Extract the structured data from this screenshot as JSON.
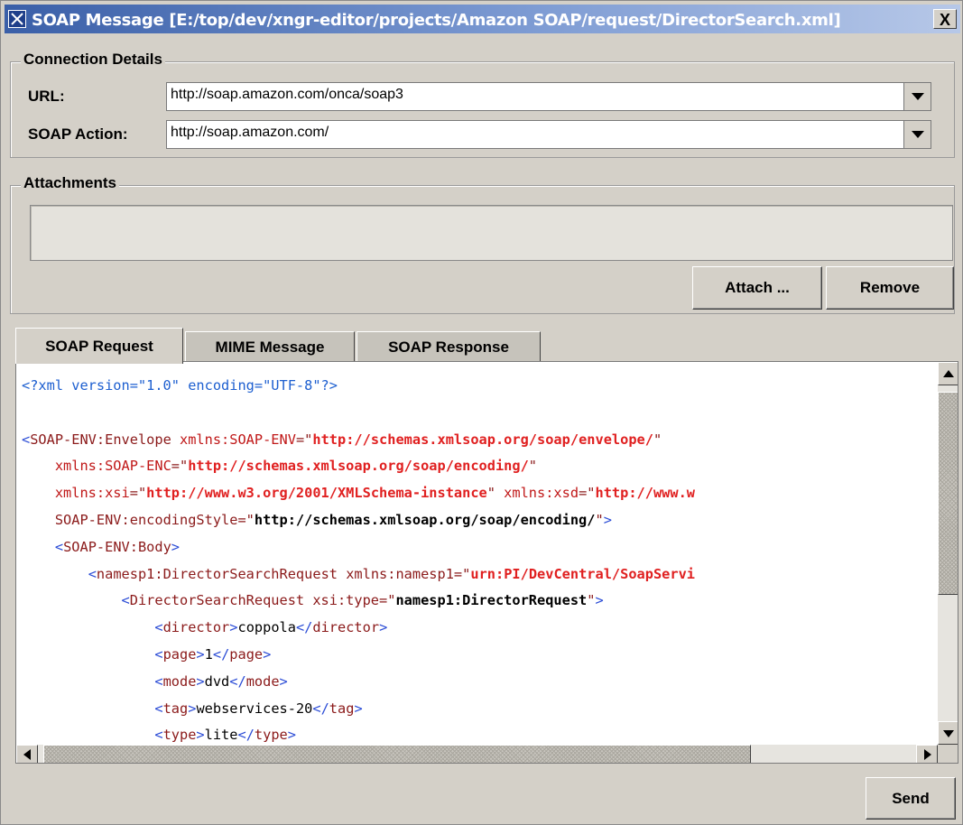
{
  "window": {
    "title": "SOAP Message [E:/top/dev/xngr-editor/projects/Amazon SOAP/request/DirectorSearch.xml]",
    "close_label": "X"
  },
  "connection": {
    "legend": "Connection Details",
    "url_label": "URL:",
    "url_value": "http://soap.amazon.com/onca/soap3",
    "action_label": "SOAP Action:",
    "action_value": "http://soap.amazon.com/"
  },
  "attachments": {
    "legend": "Attachments",
    "attach_label": "Attach ...",
    "remove_label": "Remove"
  },
  "tabs": [
    {
      "label": "SOAP Request",
      "active": true
    },
    {
      "label": "MIME Message",
      "active": false
    },
    {
      "label": "SOAP Response",
      "active": false
    }
  ],
  "editor": {
    "lines": [
      [
        [
          "pi",
          "<?xml version=\"1.0\" encoding=\"UTF-8\"?>"
        ]
      ],
      [],
      [
        [
          "br",
          "<"
        ],
        [
          "tag",
          "SOAP-ENV:Envelope "
        ],
        [
          "attr",
          "xmlns:SOAP-ENV"
        ],
        [
          "tag",
          "=\""
        ],
        [
          "val",
          "http://schemas.xmlsoap.org/soap/envelope/"
        ],
        [
          "tag",
          "\""
        ]
      ],
      [
        [
          "t",
          "    "
        ],
        [
          "attr",
          "xmlns:SOAP-ENC"
        ],
        [
          "tag",
          "=\""
        ],
        [
          "val",
          "http://schemas.xmlsoap.org/soap/encoding/"
        ],
        [
          "tag",
          "\""
        ]
      ],
      [
        [
          "t",
          "    "
        ],
        [
          "attr",
          "xmlns:xsi"
        ],
        [
          "tag",
          "=\""
        ],
        [
          "val",
          "http://www.w3.org/2001/XMLSchema-instance"
        ],
        [
          "tag",
          "\" "
        ],
        [
          "attr",
          "xmlns:xsd"
        ],
        [
          "tag",
          "=\""
        ],
        [
          "val",
          "http://www.w"
        ]
      ],
      [
        [
          "t",
          "    "
        ],
        [
          "tag",
          "SOAP-ENV:encodingStyle=\""
        ],
        [
          "valb",
          "http://schemas.xmlsoap.org/soap/encoding/"
        ],
        [
          "tag",
          "\""
        ],
        [
          "br",
          ">"
        ]
      ],
      [
        [
          "t",
          "    "
        ],
        [
          "br",
          "<"
        ],
        [
          "tag",
          "SOAP-ENV:Body"
        ],
        [
          "br",
          ">"
        ]
      ],
      [
        [
          "t",
          "        "
        ],
        [
          "br",
          "<"
        ],
        [
          "tag",
          "namesp1:DirectorSearchRequest "
        ],
        [
          "tag",
          "xmlns:namesp1=\""
        ],
        [
          "val",
          "urn:PI/DevCentral/SoapServi"
        ]
      ],
      [
        [
          "t",
          "            "
        ],
        [
          "br",
          "<"
        ],
        [
          "tag",
          "DirectorSearchRequest "
        ],
        [
          "tag",
          "xsi:type=\""
        ],
        [
          "valb",
          "namesp1:DirectorRequest"
        ],
        [
          "tag",
          "\""
        ],
        [
          "br",
          ">"
        ]
      ],
      [
        [
          "t",
          "                "
        ],
        [
          "br",
          "<"
        ],
        [
          "tag",
          "director"
        ],
        [
          "br",
          ">"
        ],
        [
          "t",
          "coppola"
        ],
        [
          "br",
          "</"
        ],
        [
          "tag",
          "director"
        ],
        [
          "br",
          ">"
        ]
      ],
      [
        [
          "t",
          "                "
        ],
        [
          "br",
          "<"
        ],
        [
          "tag",
          "page"
        ],
        [
          "br",
          ">"
        ],
        [
          "t",
          "1"
        ],
        [
          "br",
          "</"
        ],
        [
          "tag",
          "page"
        ],
        [
          "br",
          ">"
        ]
      ],
      [
        [
          "t",
          "                "
        ],
        [
          "br",
          "<"
        ],
        [
          "tag",
          "mode"
        ],
        [
          "br",
          ">"
        ],
        [
          "t",
          "dvd"
        ],
        [
          "br",
          "</"
        ],
        [
          "tag",
          "mode"
        ],
        [
          "br",
          ">"
        ]
      ],
      [
        [
          "t",
          "                "
        ],
        [
          "br",
          "<"
        ],
        [
          "tag",
          "tag"
        ],
        [
          "br",
          ">"
        ],
        [
          "t",
          "webservices-20"
        ],
        [
          "br",
          "</"
        ],
        [
          "tag",
          "tag"
        ],
        [
          "br",
          ">"
        ]
      ],
      [
        [
          "t",
          "                "
        ],
        [
          "br",
          "<"
        ],
        [
          "tag",
          "type"
        ],
        [
          "br",
          ">"
        ],
        [
          "t",
          "lite"
        ],
        [
          "br",
          "</"
        ],
        [
          "tag",
          "type"
        ],
        [
          "br",
          ">"
        ]
      ]
    ]
  },
  "footer": {
    "send_label": "Send"
  },
  "colors": {
    "window_bg": "#d4d0c8",
    "title_start": "#3a5fa8",
    "tag": "#8b1a1a",
    "attr_value": "#e02020",
    "processing_instruction": "#1d5fd0"
  }
}
